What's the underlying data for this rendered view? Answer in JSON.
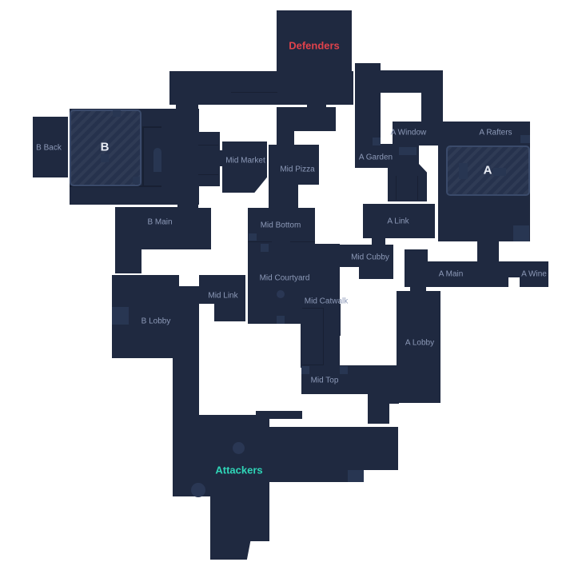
{
  "map": {
    "background_color": "#ffffff",
    "floor_color": "#1f2940",
    "spawns": {
      "defenders": {
        "label": "Defenders",
        "color": "#e0424b"
      },
      "attackers": {
        "label": "Attackers",
        "color": "#2fd6b8"
      }
    },
    "sites": {
      "a": {
        "label": "A"
      },
      "b": {
        "label": "B"
      }
    },
    "callouts": [
      "B Back",
      "Mid Market",
      "Mid Pizza",
      "A Window",
      "A Rafters",
      "A Garden",
      "B Main",
      "Mid Bottom",
      "A Link",
      "Mid Cubby",
      "Mid Courtyard",
      "A Main",
      "A Wine",
      "Mid Link",
      "Mid Catwalk",
      "B Lobby",
      "A Lobby",
      "Mid Top"
    ]
  }
}
